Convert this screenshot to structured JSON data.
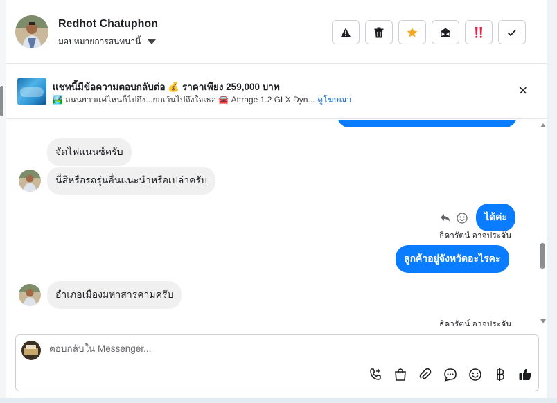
{
  "header": {
    "user_name": "Redhot Chatuphon",
    "assign_label": "มอบหมายการสนทนานี้",
    "actions": [
      {
        "name": "report-button",
        "icon": "warning-icon"
      },
      {
        "name": "delete-button",
        "icon": "trash-icon"
      },
      {
        "name": "star-button",
        "icon": "star-icon"
      },
      {
        "name": "mark-unread-button",
        "icon": "envelope-open-icon"
      },
      {
        "name": "follow-up-button",
        "icon": "exclamation-icon"
      },
      {
        "name": "mark-done-button",
        "icon": "check-icon"
      }
    ]
  },
  "ad": {
    "title": "แชทนี้มีข้อความตอบกลับต่อ 💰 ราคาเพียง 259,000 บาท",
    "subtitle": "🏞️ ถนนยาวแค่ไหนก็ไปถึง...ยกเว้นไปถึงใจเธอ 🚘 Attrage 1.2 GLX Dyn...",
    "link_label": "ดูโฆษณา",
    "close": "×"
  },
  "messages": {
    "in_1": "จัดไฟแนนซ์ครับ",
    "in_2": "นี่สีหรือรถรุ่นอื่นแนะนำหรือเปล่าครับ",
    "out_1": "ได้ค่ะ",
    "sender_1": "ธิดารัตน์ อาจประจัน",
    "out_2": "ลูกค้าอยู่จังหวัดอะไรคะ",
    "in_3": "อำเภอเมืองมหาสารคามครับ",
    "sender_2": "ธิดารัตน์ อาจประจัน"
  },
  "composer": {
    "placeholder": "ตอบกลับใน Messenger..."
  },
  "colors": {
    "accent": "#0a7cff",
    "incoming": "#f0f0f0",
    "star": "#f5a623",
    "alert": "#e41e3f",
    "link": "#1b6fd6"
  }
}
